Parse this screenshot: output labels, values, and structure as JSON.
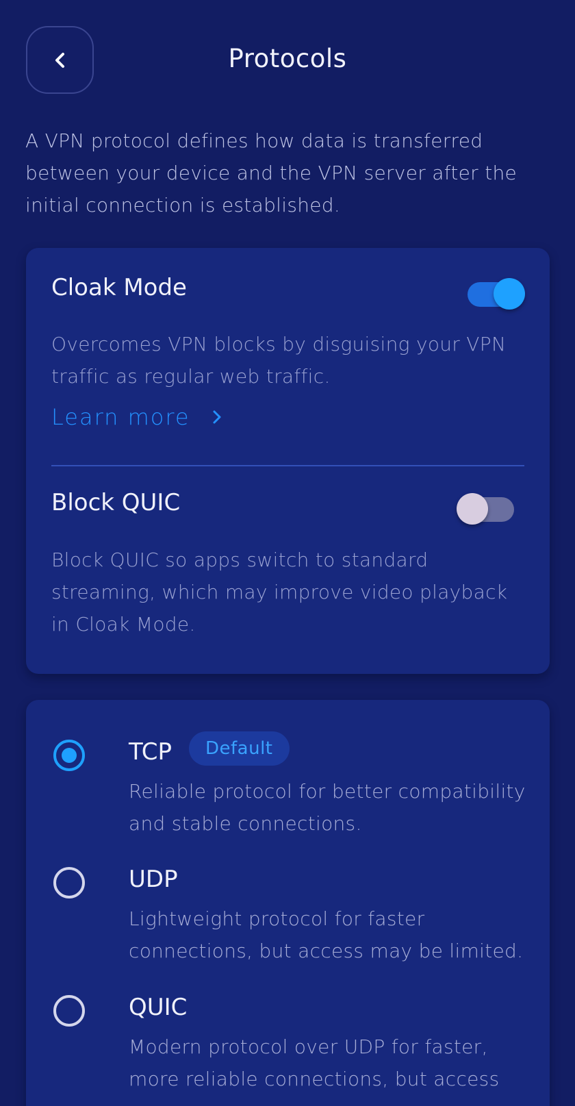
{
  "header": {
    "title": "Protocols",
    "back_icon": "chevron-left-icon"
  },
  "intro": "A VPN protocol defines how data is transferred between your device and the VPN server after the initial connection is established.",
  "cloak_mode": {
    "title": "Cloak Mode",
    "description": "Overcomes VPN blocks by disguising your VPN traffic as regular web traffic.",
    "learn_more": "Learn more",
    "enabled": true
  },
  "block_quic": {
    "title": "Block QUIC",
    "description": "Block QUIC so apps switch to standard streaming, which may improve video playback in Cloak Mode.",
    "enabled": false
  },
  "protocols": [
    {
      "name": "TCP",
      "badge": "Default",
      "description": "Reliable protocol for better compatibility and stable connections.",
      "selected": true
    },
    {
      "name": "UDP",
      "description": "Lightweight protocol for faster connections, but access may be limited.",
      "selected": false
    },
    {
      "name": "QUIC",
      "description": "Modern protocol over UDP for faster, more reliable connections, but access",
      "selected": false
    }
  ],
  "colors": {
    "background": "#121d63",
    "card": "#17287d",
    "accent": "#1ea1ff",
    "link": "#2491ff"
  }
}
